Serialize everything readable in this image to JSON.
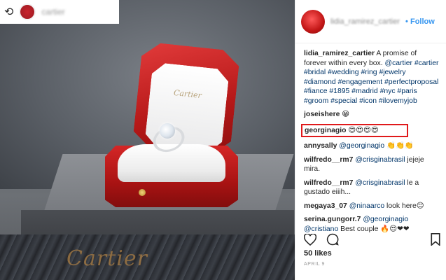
{
  "repost_header": {
    "account_name": "cartier"
  },
  "photo": {
    "lid_brand_text": "Cartier",
    "marble_text": "Cartier"
  },
  "post": {
    "header": {
      "account_name": "lidia_ramirez_cartier",
      "follow_label": "Follow"
    },
    "caption": {
      "username": "lidia_ramirez_cartier",
      "text": "A promise of forever within every box.",
      "mention": "@cartier",
      "hashtags": "#cartier #bridal #wedding #ring #jewelry #diamond #engagement #perfectproposal #fiance #1895 #madrid #nyc #paris #groom #special #icon #ilovemyjob"
    },
    "comments": [
      {
        "username": "joseishere",
        "mention": "",
        "text": "",
        "emoji": "😁"
      },
      {
        "username": "georginagio",
        "mention": "",
        "text": "",
        "emoji": "😍😍😍😍"
      },
      {
        "username": "annysally",
        "mention": "@georginagio",
        "text": "",
        "emoji": "👏👏👏"
      },
      {
        "username": "wilfredo__rm7",
        "mention": "@crisginabrasil",
        "text": "jejeje mira.",
        "emoji": ""
      },
      {
        "username": "wilfredo__rm7",
        "mention": "@crisginabrasil",
        "text": "le a gustado eiiih...",
        "emoji": ""
      },
      {
        "username": "megaya3_07",
        "mention": "@ninaarco",
        "text": "look here",
        "emoji": "😊"
      },
      {
        "username": "serina.gungorr.7",
        "mention": "@georginagio @cristiano",
        "text": "Best couple",
        "emoji": "🔥😍❤❤"
      }
    ],
    "likes": "50 likes",
    "date": "APRIL 9"
  },
  "colors": {
    "link": "#003569",
    "follow": "#3897f0",
    "highlight_border": "#e0191b",
    "box_red": "#c21616"
  }
}
